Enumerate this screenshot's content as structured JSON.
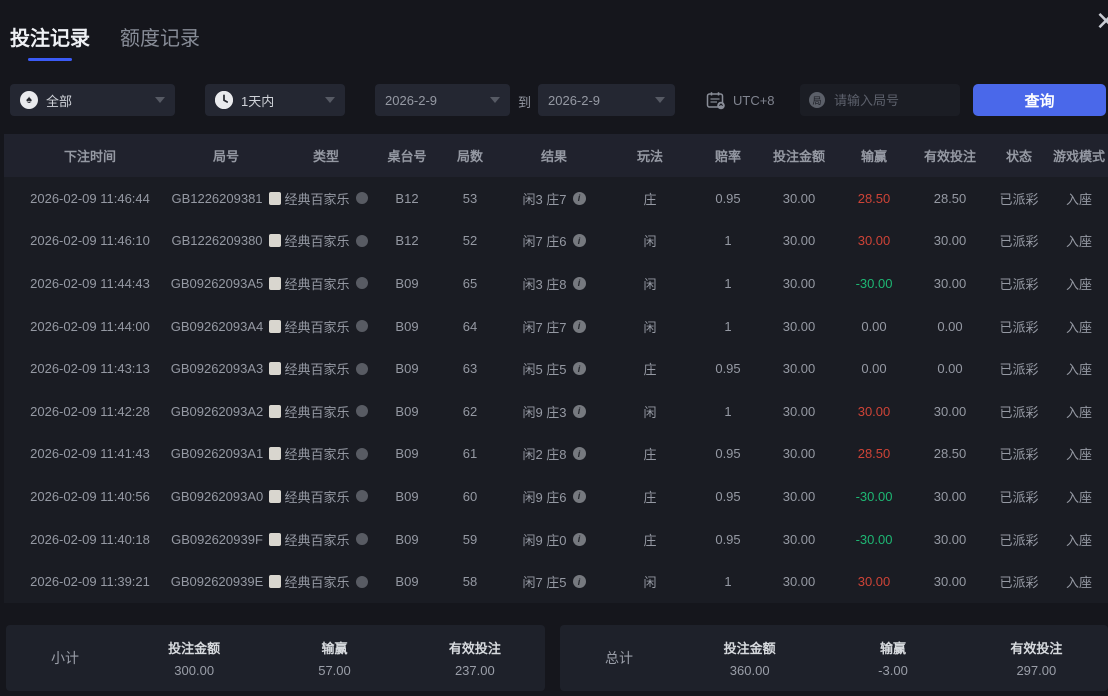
{
  "tabs": [
    {
      "label": "投注记录",
      "active": true
    },
    {
      "label": "额度记录",
      "active": false
    }
  ],
  "close_icon": "✕",
  "filters": {
    "game_type": {
      "value": "全部",
      "icon": "spade-circle-icon"
    },
    "time_range": {
      "value": "1天内",
      "icon": "clock-icon"
    },
    "date_from": "2026-2-9",
    "to_label": "到",
    "date_to": "2026-2-9",
    "timezone": {
      "label": "UTC+8",
      "icon": "calendar-icon"
    },
    "search": {
      "placeholder": "请输入局号",
      "icon": "round-number-icon",
      "icon_glyph": "局",
      "value": ""
    },
    "query_button": "查询"
  },
  "table": {
    "headers": [
      "下注时间",
      "局号",
      "类型",
      "桌台号",
      "局数",
      "结果",
      "玩法",
      "赔率",
      "投注金额",
      "输赢",
      "有效投注",
      "状态",
      "游戏模式"
    ],
    "rows": [
      {
        "time": "2026-02-09 11:46:44",
        "round_id": "GB1226209381",
        "type": "经典百家乐",
        "table_no": "B12",
        "round_no": "53",
        "result": "闲3 庄7",
        "play": "庄",
        "odds": "0.95",
        "bet": "30.00",
        "win": "28.50",
        "win_color": "red",
        "valid": "28.50",
        "status": "已派彩",
        "mode": "入座"
      },
      {
        "time": "2026-02-09 11:46:10",
        "round_id": "GB1226209380",
        "type": "经典百家乐",
        "table_no": "B12",
        "round_no": "52",
        "result": "闲7 庄6",
        "play": "闲",
        "odds": "1",
        "bet": "30.00",
        "win": "30.00",
        "win_color": "red",
        "valid": "30.00",
        "status": "已派彩",
        "mode": "入座"
      },
      {
        "time": "2026-02-09 11:44:43",
        "round_id": "GB09262093A5",
        "type": "经典百家乐",
        "table_no": "B09",
        "round_no": "65",
        "result": "闲3 庄8",
        "play": "闲",
        "odds": "1",
        "bet": "30.00",
        "win": "-30.00",
        "win_color": "green",
        "valid": "30.00",
        "status": "已派彩",
        "mode": "入座"
      },
      {
        "time": "2026-02-09 11:44:00",
        "round_id": "GB09262093A4",
        "type": "经典百家乐",
        "table_no": "B09",
        "round_no": "64",
        "result": "闲7 庄7",
        "play": "闲",
        "odds": "1",
        "bet": "30.00",
        "win": "0.00",
        "win_color": "neutral",
        "valid": "0.00",
        "status": "已派彩",
        "mode": "入座"
      },
      {
        "time": "2026-02-09 11:43:13",
        "round_id": "GB09262093A3",
        "type": "经典百家乐",
        "table_no": "B09",
        "round_no": "63",
        "result": "闲5 庄5",
        "play": "庄",
        "odds": "0.95",
        "bet": "30.00",
        "win": "0.00",
        "win_color": "neutral",
        "valid": "0.00",
        "status": "已派彩",
        "mode": "入座"
      },
      {
        "time": "2026-02-09 11:42:28",
        "round_id": "GB09262093A2",
        "type": "经典百家乐",
        "table_no": "B09",
        "round_no": "62",
        "result": "闲9 庄3",
        "play": "闲",
        "odds": "1",
        "bet": "30.00",
        "win": "30.00",
        "win_color": "red",
        "valid": "30.00",
        "status": "已派彩",
        "mode": "入座"
      },
      {
        "time": "2026-02-09 11:41:43",
        "round_id": "GB09262093A1",
        "type": "经典百家乐",
        "table_no": "B09",
        "round_no": "61",
        "result": "闲2 庄8",
        "play": "庄",
        "odds": "0.95",
        "bet": "30.00",
        "win": "28.50",
        "win_color": "red",
        "valid": "28.50",
        "status": "已派彩",
        "mode": "入座"
      },
      {
        "time": "2026-02-09 11:40:56",
        "round_id": "GB09262093A0",
        "type": "经典百家乐",
        "table_no": "B09",
        "round_no": "60",
        "result": "闲9 庄6",
        "play": "庄",
        "odds": "0.95",
        "bet": "30.00",
        "win": "-30.00",
        "win_color": "green",
        "valid": "30.00",
        "status": "已派彩",
        "mode": "入座"
      },
      {
        "time": "2026-02-09 11:40:18",
        "round_id": "GB092620939F",
        "type": "经典百家乐",
        "table_no": "B09",
        "round_no": "59",
        "result": "闲9 庄0",
        "play": "庄",
        "odds": "0.95",
        "bet": "30.00",
        "win": "-30.00",
        "win_color": "green",
        "valid": "30.00",
        "status": "已派彩",
        "mode": "入座"
      },
      {
        "time": "2026-02-09 11:39:21",
        "round_id": "GB092620939E",
        "type": "经典百家乐",
        "table_no": "B09",
        "round_no": "58",
        "result": "闲7 庄5",
        "play": "闲",
        "odds": "1",
        "bet": "30.00",
        "win": "30.00",
        "win_color": "red",
        "valid": "30.00",
        "status": "已派彩",
        "mode": "入座"
      }
    ]
  },
  "summary": {
    "subtotal": {
      "label": "小计",
      "bet_label": "投注金额",
      "bet": "300.00",
      "win_label": "输赢",
      "win": "57.00",
      "win_color": "red",
      "valid_label": "有效投注",
      "valid": "237.00"
    },
    "total": {
      "label": "总计",
      "bet_label": "投注金额",
      "bet": "360.00",
      "win_label": "输赢",
      "win": "-3.00",
      "win_color": "green",
      "valid_label": "有效投注",
      "valid": "297.00"
    }
  },
  "colors": {
    "accent_blue": "#4a68ea",
    "tab_underline": "#3b5bf6",
    "win_red": "#cd4337",
    "win_green": "#1eb673"
  }
}
